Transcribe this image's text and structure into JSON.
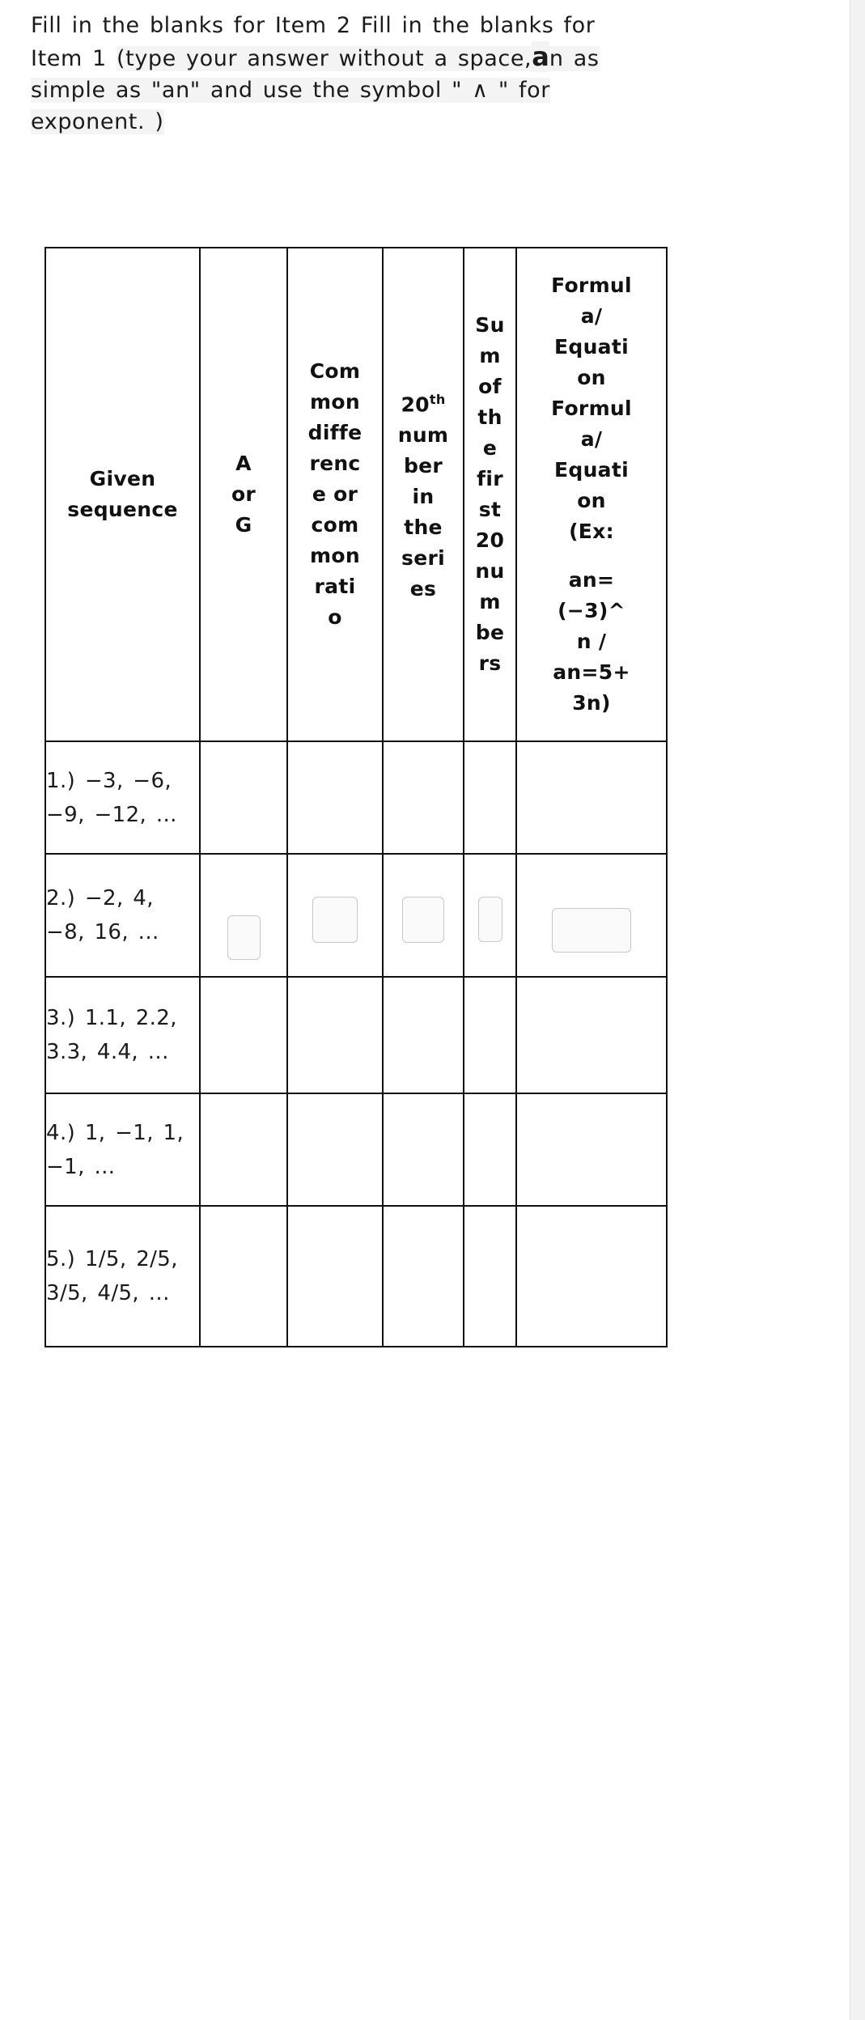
{
  "instructions": {
    "line1_plain": "Fill in the blanks for Item 2   Fill in the blanks for",
    "line2_plain": "Item 1 ",
    "line2_hl": "(type your answer without a space,",
    "line2_big": "a",
    "line2_tail": "n as",
    "line3_hl": "simple as \"an\" and use the symbol  \" ∧ \" for",
    "line4_hl": "exponent. )"
  },
  "table": {
    "headers": [
      {
        "id": "given-sequence",
        "lines": [
          "Given",
          "sequence"
        ]
      },
      {
        "id": "a-or-g",
        "lines": [
          "A",
          "or",
          "G"
        ]
      },
      {
        "id": "common-difference-or-ratio",
        "lines": [
          "Com",
          "mon",
          "diffe",
          "renc",
          "e or",
          "com",
          "mon",
          "rati",
          "o"
        ]
      },
      {
        "id": "twentieth-number",
        "lines": [
          "20th",
          "num",
          "ber",
          "in",
          "the",
          "seri",
          "es"
        ]
      },
      {
        "id": "sum-of-first-20",
        "lines": [
          "Su",
          "m",
          "of",
          "th",
          "e",
          "fir",
          "st",
          "20",
          "nu",
          "m",
          "be",
          "rs"
        ]
      },
      {
        "id": "formula-equation",
        "lines": [
          "Formul",
          "a/",
          "Equati",
          "on",
          "Formul",
          "a/",
          "Equati",
          "on",
          "(Ex:",
          "",
          "an=",
          "(−3)^",
          "n /",
          "an=5+",
          "3n)"
        ]
      }
    ],
    "rows": [
      {
        "id": "row-1",
        "sequence": "1.) −3, −6, −9, −12, ...",
        "has_inputs": false
      },
      {
        "id": "row-2",
        "sequence": "2.) −2, 4, −8, 16, ...",
        "has_inputs": true
      },
      {
        "id": "row-3",
        "sequence": "3.) 1.1, 2.2, 3.3, 4.4, ...",
        "has_inputs": false
      },
      {
        "id": "row-4",
        "sequence": "4.) 1, −1, 1, −1, ...",
        "has_inputs": false
      },
      {
        "id": "row-5",
        "sequence": "5.) 1/5, 2/5, 3/5, 4/5, ...",
        "has_inputs": false
      }
    ],
    "input_values": {
      "a_or_g": "",
      "common_difference": "",
      "twentieth_number": "",
      "sum_first_20": "",
      "formula_equation": ""
    }
  }
}
